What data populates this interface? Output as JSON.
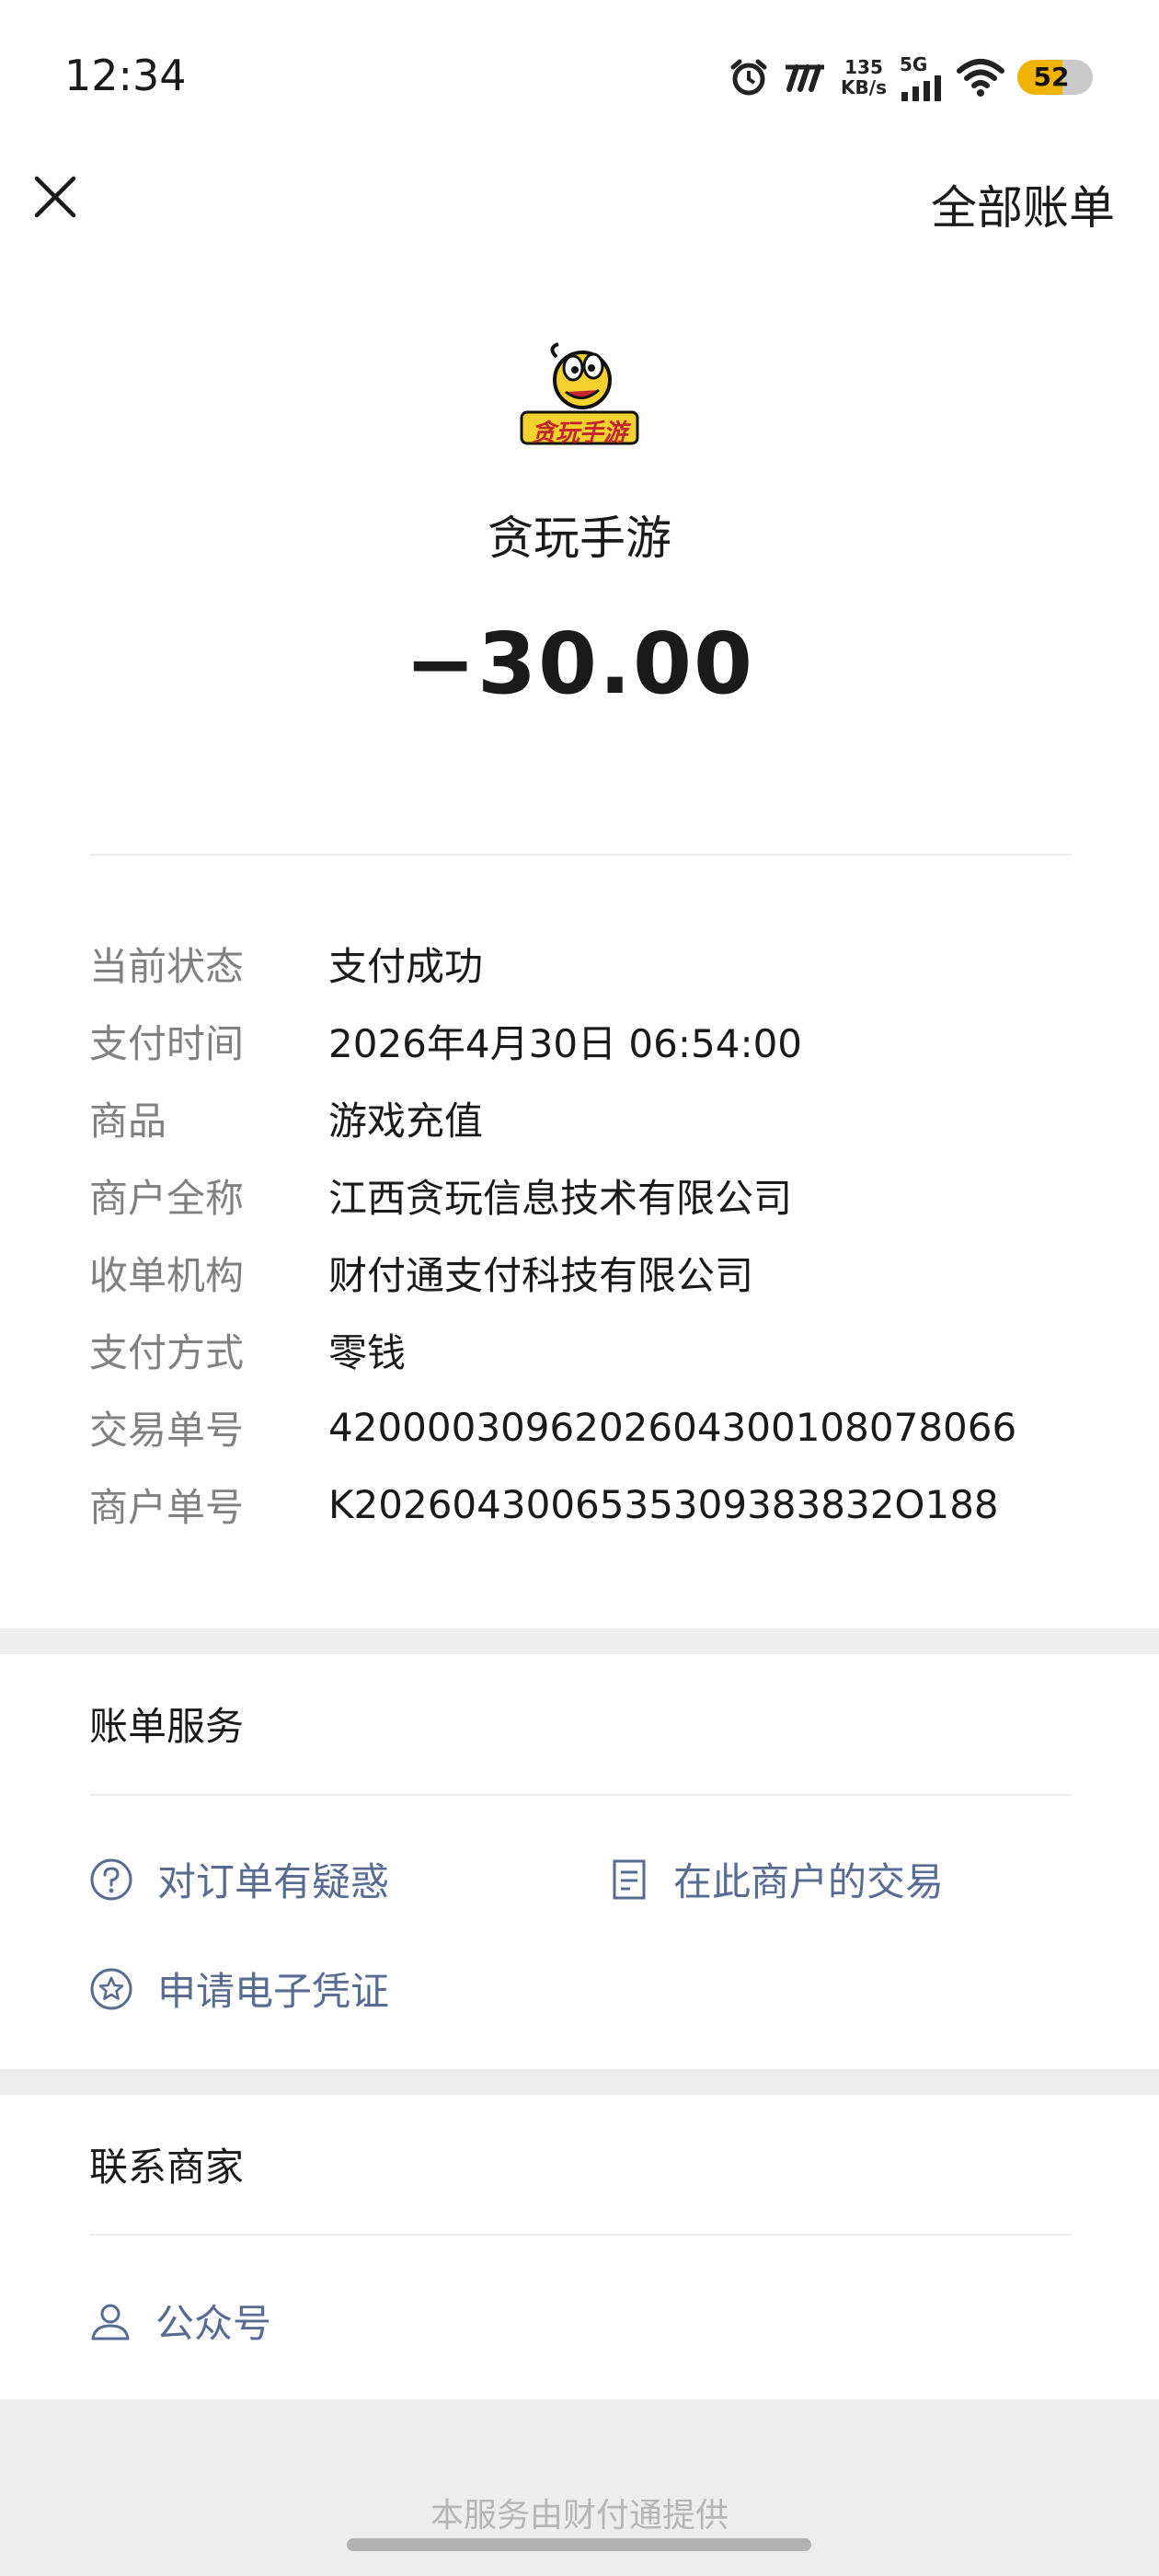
{
  "status_bar": {
    "time": "12:34",
    "net_speed_value": "135",
    "net_speed_unit": "KB/s",
    "network_type": "5G",
    "battery_level": "52",
    "icons": [
      "alarm-icon",
      "app-indicator-icon",
      "cellular-signal-icon",
      "wifi-icon",
      "battery-icon"
    ]
  },
  "nav": {
    "close_icon": "close-icon",
    "all_bills_label": "全部账单"
  },
  "merchant": {
    "logo_text": "贪玩手游",
    "name": "贪玩手游",
    "amount": "−30.00"
  },
  "details": [
    {
      "label": "当前状态",
      "value": "支付成功"
    },
    {
      "label": "支付时间",
      "value": "2026年4月30日 06:54:00"
    },
    {
      "label": "商品",
      "value": "游戏充值"
    },
    {
      "label": "商户全称",
      "value": "江西贪玩信息技术有限公司"
    },
    {
      "label": "收单机构",
      "value": "财付通支付科技有限公司"
    },
    {
      "label": "支付方式",
      "value": "零钱"
    },
    {
      "label": "交易单号",
      "value": "4200003096202604300108078066"
    },
    {
      "label": "商户单号",
      "value": "K2026043006535309383832O188"
    }
  ],
  "bill_service": {
    "title": "账单服务",
    "items": [
      {
        "label": "对订单有疑惑",
        "icon": "question-circle-icon"
      },
      {
        "label": "在此商户的交易",
        "icon": "document-icon"
      },
      {
        "label": "申请电子凭证",
        "icon": "star-circle-icon"
      }
    ]
  },
  "contact_merchant": {
    "title": "联系商家",
    "items": [
      {
        "label": "公众号",
        "icon": "person-icon"
      }
    ]
  },
  "footer": {
    "note": "本服务由财付通提供"
  },
  "colors": {
    "link": "#586c93",
    "label_gray": "#808080",
    "band_gray": "#ededed",
    "battery_accent": "#f0b400"
  }
}
